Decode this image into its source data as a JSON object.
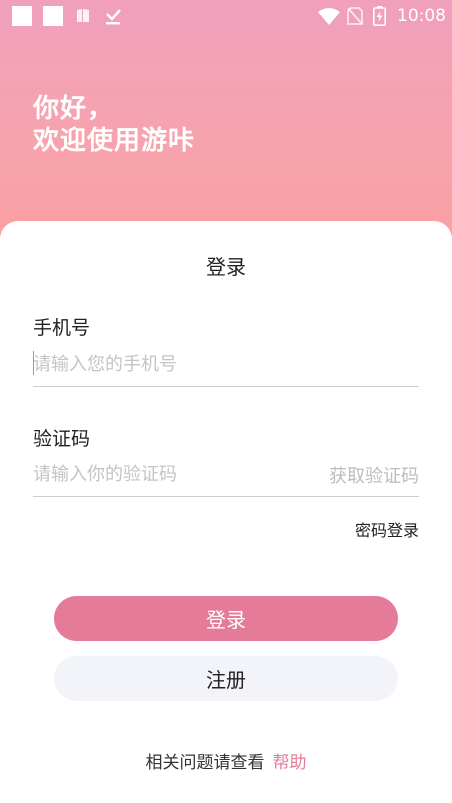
{
  "status_bar": {
    "time": "10:08",
    "icons": [
      "notification-square-icon",
      "notification-square-icon",
      "book-icon",
      "download-done-icon",
      "wifi-icon",
      "no-sim-icon",
      "battery-charging-icon"
    ]
  },
  "greeting": {
    "line1": "你好，",
    "line2": "欢迎使用游咔"
  },
  "login_card": {
    "title": "登录",
    "phone": {
      "label": "手机号",
      "placeholder": "请输入您的手机号",
      "value": ""
    },
    "code": {
      "label": "验证码",
      "placeholder": "请输入你的验证码",
      "value": "",
      "get_code_label": "获取验证码"
    },
    "password_login_label": "密码登录",
    "login_button_label": "登录",
    "register_button_label": "注册"
  },
  "footer": {
    "text": "相关问题请查看",
    "help_link": "帮助"
  },
  "colors": {
    "accent": "#e47b99",
    "header_gradient_top": "#f0a0bd",
    "header_gradient_bottom": "#fb9e9f",
    "register_button_bg": "#f3f4fa"
  }
}
